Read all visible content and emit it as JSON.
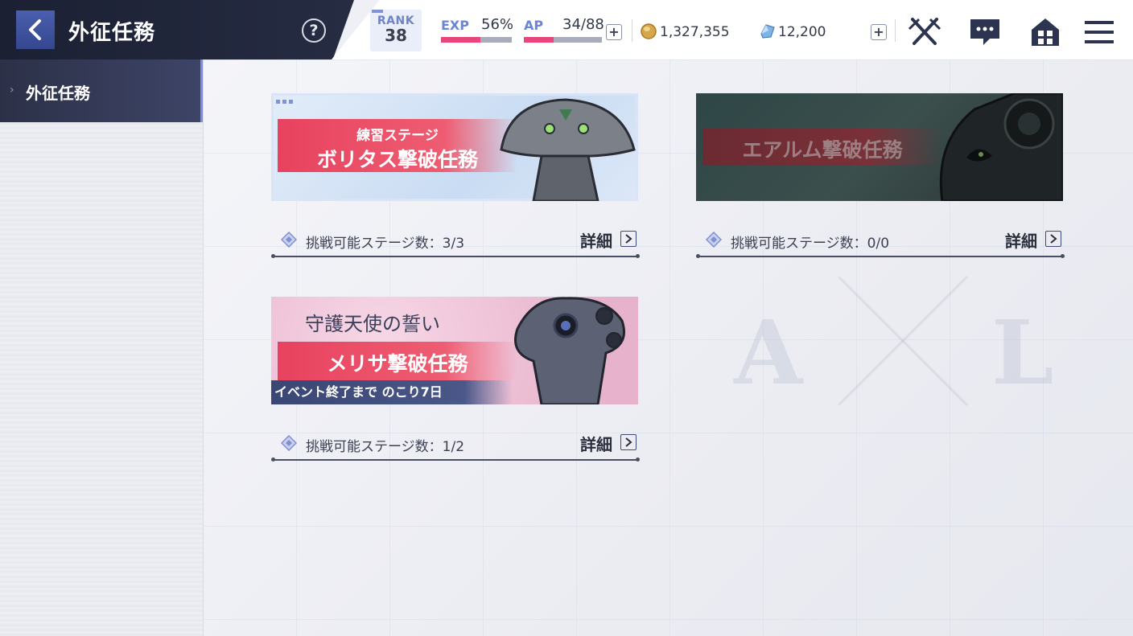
{
  "header": {
    "title": "外征任務",
    "help": "?",
    "rank_label": "RANK",
    "rank_value": "38",
    "exp_label": "EXP",
    "exp_value": "56%",
    "exp_fraction": 0.56,
    "ap_label": "AP",
    "ap_value": "34/88",
    "ap_fraction": 0.386,
    "ap_plus": "+",
    "coins": "1,327,355",
    "gems": "12,200",
    "gems_plus": "+"
  },
  "sidebar": {
    "items": [
      {
        "label": "外征任務",
        "active": true
      }
    ]
  },
  "missions": [
    {
      "subtitle": "練習ステージ",
      "title": "ボリタス撃破任務",
      "stages_text": "挑戦可能ステージ数：3/3",
      "detail_label": "詳細",
      "enabled": true
    },
    {
      "title": "エアルム撃破任務",
      "stages_text": "挑戦可能ステージ数：0/0",
      "detail_label": "詳細",
      "enabled": false
    },
    {
      "subtitle": "守護天使の誓い",
      "title": "メリサ撃破任務",
      "event_text": "イベント終了まで のこり7日",
      "stages_text": "挑戦可能ステージ数：1/2",
      "detail_label": "詳細",
      "enabled": true
    }
  ],
  "colors": {
    "accent": "#e8467a",
    "ribbon": "#e8425f",
    "nav_dark": "#1b2033",
    "link_blue": "#6b86d8"
  }
}
